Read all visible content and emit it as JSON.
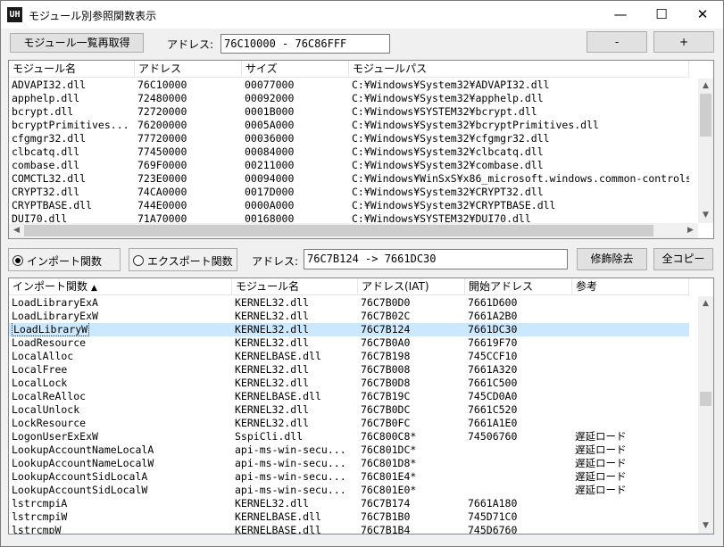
{
  "window": {
    "title": "モジュール別参照関数表示",
    "app_icon_text": "UH",
    "minimize_glyph": "—",
    "maximize_glyph": "☐",
    "close_glyph": "✕"
  },
  "toolbar": {
    "reload_label": "モジュール一覧再取得",
    "address_label": "アドレス:",
    "address_value": "76C10000 - 76C86FFF",
    "minus_label": "-",
    "plus_label": "+"
  },
  "modules": {
    "columns": [
      "モジュール名",
      "アドレス",
      "サイズ",
      "モジュールパス"
    ],
    "rows": [
      [
        "ADVAPI32.dll",
        "76C10000",
        "00077000",
        "C:¥Windows¥System32¥ADVAPI32.dll"
      ],
      [
        "apphelp.dll",
        "72480000",
        "00092000",
        "C:¥Windows¥System32¥apphelp.dll"
      ],
      [
        "bcrypt.dll",
        "72720000",
        "0001B000",
        "C:¥Windows¥SYSTEM32¥bcrypt.dll"
      ],
      [
        "bcryptPrimitives...",
        "76200000",
        "0005A000",
        "C:¥Windows¥System32¥bcryptPrimitives.dll"
      ],
      [
        "cfgmgr32.dll",
        "77720000",
        "00036000",
        "C:¥Windows¥System32¥cfgmgr32.dll"
      ],
      [
        "clbcatq.dll",
        "77450000",
        "00084000",
        "C:¥Windows¥System32¥clbcatq.dll"
      ],
      [
        "combase.dll",
        "769F0000",
        "00211000",
        "C:¥Windows¥System32¥combase.dll"
      ],
      [
        "COMCTL32.dll",
        "723E0000",
        "00094000",
        "C:¥Windows¥WinSxS¥x86_microsoft.windows.common-controls"
      ],
      [
        "CRYPT32.dll",
        "74CA0000",
        "0017D000",
        "C:¥Windows¥System32¥CRYPT32.dll"
      ],
      [
        "CRYPTBASE.dll",
        "744E0000",
        "0000A000",
        "C:¥Windows¥System32¥CRYPTBASE.dll"
      ],
      [
        "DUI70.dll",
        "71A70000",
        "00168000",
        "C:¥Windows¥SYSTEM32¥DUI70.dll"
      ]
    ]
  },
  "mode": {
    "import_label": "インポート関数",
    "export_label": "エクスポート関数",
    "selected": "import",
    "address_label": "アドレス:",
    "address_value": "76C7B124 -> 7661DC30",
    "strip_label": "修飾除去",
    "copy_all_label": "全コピー"
  },
  "functions": {
    "columns": [
      "インポート関数",
      "モジュール名",
      "アドレス(IAT)",
      "開始アドレス",
      "参考"
    ],
    "sort_indicator": "▲",
    "selected_index": 2,
    "rows": [
      [
        "LoadLibraryExA",
        "KERNEL32.dll",
        "76C7B0D0",
        "7661D600",
        ""
      ],
      [
        "LoadLibraryExW",
        "KERNEL32.dll",
        "76C7B02C",
        "7661A2B0",
        ""
      ],
      [
        "LoadLibraryW",
        "KERNEL32.dll",
        "76C7B124",
        "7661DC30",
        ""
      ],
      [
        "LoadResource",
        "KERNEL32.dll",
        "76C7B0A0",
        "76619F70",
        ""
      ],
      [
        "LocalAlloc",
        "KERNELBASE.dll",
        "76C7B198",
        "745CCF10",
        ""
      ],
      [
        "LocalFree",
        "KERNEL32.dll",
        "76C7B008",
        "7661A320",
        ""
      ],
      [
        "LocalLock",
        "KERNEL32.dll",
        "76C7B0D8",
        "7661C500",
        ""
      ],
      [
        "LocalReAlloc",
        "KERNELBASE.dll",
        "76C7B19C",
        "745CD0A0",
        ""
      ],
      [
        "LocalUnlock",
        "KERNEL32.dll",
        "76C7B0DC",
        "7661C520",
        ""
      ],
      [
        "LockResource",
        "KERNEL32.dll",
        "76C7B0FC",
        "7661A1E0",
        ""
      ],
      [
        "LogonUserExExW",
        "SspiCli.dll",
        "76C800C8*",
        "74506760",
        "遅延ロード"
      ],
      [
        "LookupAccountNameLocalA",
        "api-ms-win-secu...",
        "76C801DC*",
        "",
        "遅延ロード"
      ],
      [
        "LookupAccountNameLocalW",
        "api-ms-win-secu...",
        "76C801D8*",
        "",
        "遅延ロード"
      ],
      [
        "LookupAccountSidLocalA",
        "api-ms-win-secu...",
        "76C801E4*",
        "",
        "遅延ロード"
      ],
      [
        "LookupAccountSidLocalW",
        "api-ms-win-secu...",
        "76C801E0*",
        "",
        "遅延ロード"
      ],
      [
        "lstrcmpiA",
        "KERNEL32.dll",
        "76C7B174",
        "7661A180",
        ""
      ],
      [
        "lstrcmpiW",
        "KERNELBASE.dll",
        "76C7B1B0",
        "745D71C0",
        ""
      ],
      [
        "lstrcmpW",
        "KERNELBASE.dll",
        "76C7B1B4",
        "745D6760",
        ""
      ]
    ]
  }
}
